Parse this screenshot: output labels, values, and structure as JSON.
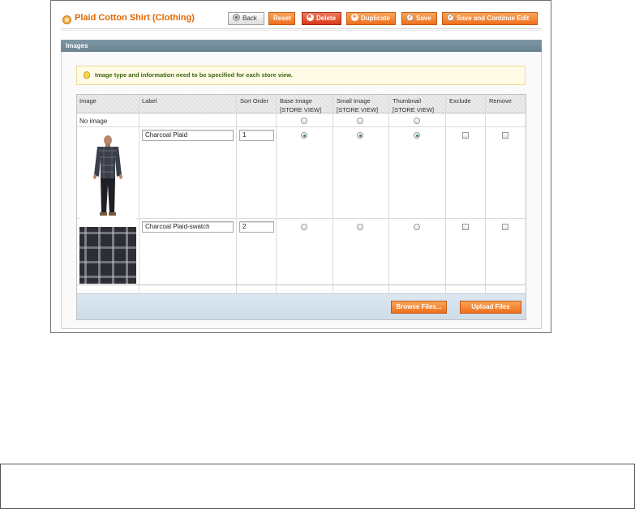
{
  "header": {
    "title": "Plaid Cotton Shirt (Clothing)",
    "buttons": {
      "back": "Back",
      "reset": "Reset",
      "delete": "Delete",
      "duplicate": "Duplicate",
      "save": "Save",
      "save_continue": "Save and Continue Edit"
    }
  },
  "section": {
    "title": "Images",
    "notice": "Image type and information need to be specified for each store view."
  },
  "grid": {
    "columns": {
      "image": "Image",
      "label": "Label",
      "sort_order": "Sort Order",
      "base_image": "Base Image",
      "small_image": "Small Image",
      "thumbnail": "Thumbnail",
      "exclude": "Exclude",
      "remove": "Remove",
      "scope": "[STORE VIEW]"
    },
    "no_image_label": "No image",
    "rows": [
      {
        "label": "Charcoal Plaid",
        "sort_order": "1",
        "base": true,
        "small": true,
        "thumb": true
      },
      {
        "label": "Charcoal Plaid-swatch",
        "sort_order": "2",
        "base": false,
        "small": false,
        "thumb": false
      }
    ],
    "footer": {
      "browse": "Browse Files...",
      "upload": "Upload Files"
    }
  },
  "colors": {
    "accent": "#ee6f1c",
    "title": "#e26703",
    "section_header": "#6a8392"
  }
}
